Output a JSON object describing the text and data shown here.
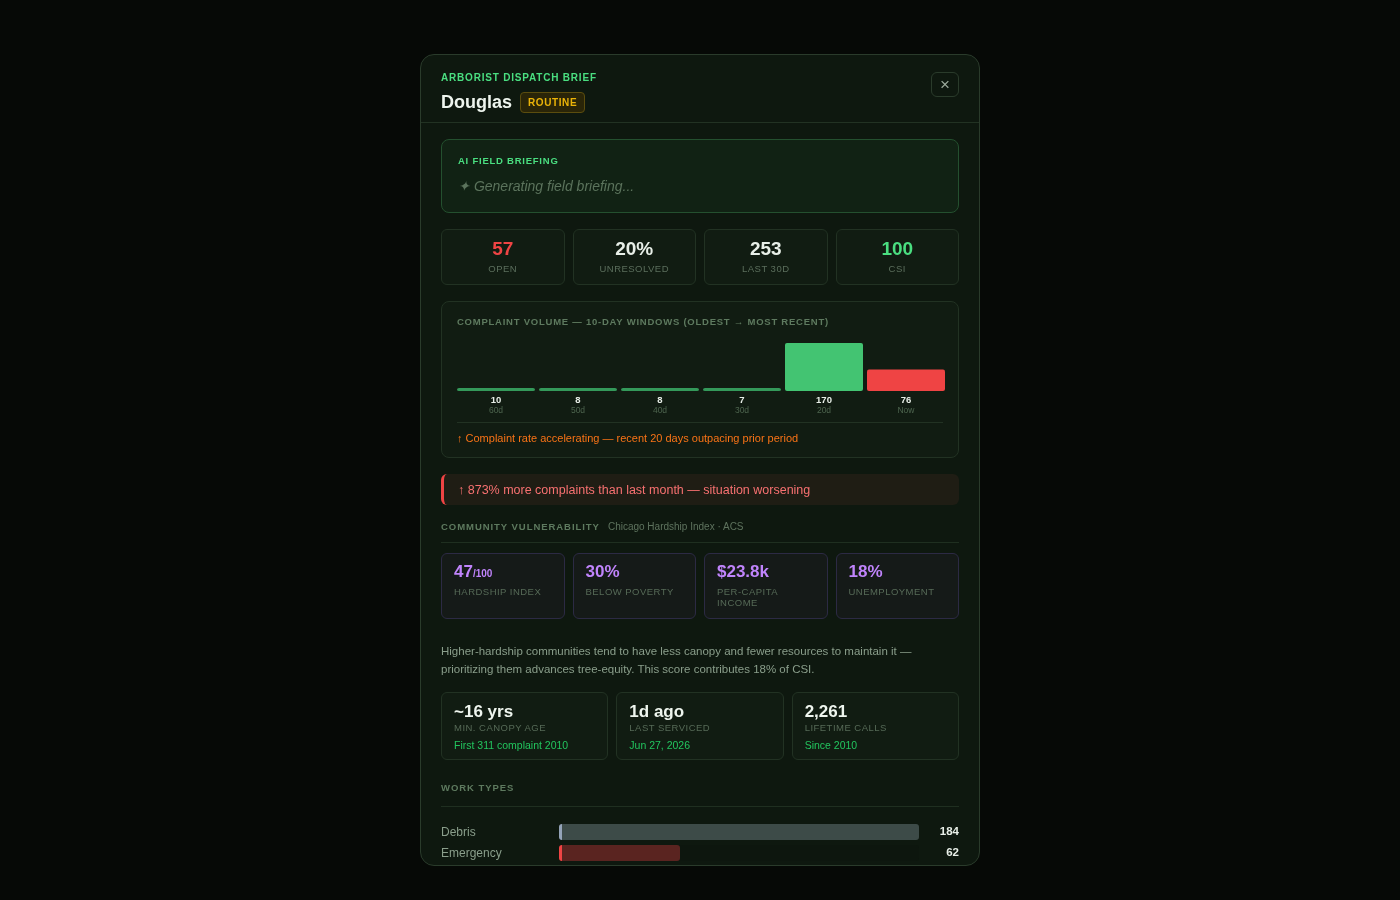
{
  "modal": {
    "eyebrow": "ARBORIST DISPATCH BRIEF",
    "title": "Douglas",
    "priority": "ROUTINE",
    "close": "×"
  },
  "briefing": {
    "heading": "AI FIELD BRIEFING",
    "status": "✦ Generating field briefing..."
  },
  "stats": [
    {
      "value": "57",
      "label": "OPEN",
      "color": "#ef4444"
    },
    {
      "value": "20%",
      "label": "UNRESOLVED",
      "color": "#e8efe8"
    },
    {
      "value": "253",
      "label": "LAST 30D",
      "color": "#e8efe8"
    },
    {
      "value": "100",
      "label": "CSI",
      "color": "#4ade80"
    }
  ],
  "volume": {
    "title": "COMPLAINT VOLUME — 10-DAY WINDOWS (OLDEST → MOST RECENT)",
    "chart_data": {
      "type": "bar",
      "categories": [
        "60d",
        "50d",
        "40d",
        "30d",
        "20d",
        "Now"
      ],
      "data_labels": true,
      "series": [
        {
          "color": "#34995a",
          "values": [
            10,
            8,
            8,
            7,
            null,
            null
          ]
        },
        {
          "color": "#43c472",
          "values": [
            null,
            null,
            null,
            null,
            170,
            null
          ]
        },
        {
          "color": "#ef4444",
          "values": [
            null,
            null,
            null,
            null,
            null,
            76
          ]
        }
      ]
    },
    "note": "↑ Complaint rate accelerating — recent 20 days outpacing prior period"
  },
  "alert": "↑ 873% more complaints than last month — situation worsening",
  "vulnerability": {
    "heading": "COMMUNITY VULNERABILITY",
    "source": "Chicago Hardship Index · ACS",
    "metrics": [
      {
        "value": "47",
        "suffix": "/100",
        "label": "HARDSHIP INDEX"
      },
      {
        "value": "30%",
        "label": "BELOW POVERTY"
      },
      {
        "value": "$23.8k",
        "label": "PER-CAPITA INCOME"
      },
      {
        "value": "18%",
        "label": "UNEMPLOYMENT"
      }
    ],
    "note": "Higher-hardship communities tend to have less canopy and fewer resources to maintain it — prioritizing them advances tree-equity. This score contributes 18% of CSI."
  },
  "history": [
    {
      "value": "~16 yrs",
      "label": "MIN. CANOPY AGE",
      "detail": "First 311 complaint 2010"
    },
    {
      "value": "1d ago",
      "label": "LAST SERVICED",
      "detail": "Jun 27, 2026"
    },
    {
      "value": "2,261",
      "label": "LIFETIME CALLS",
      "detail": "Since 2010"
    }
  ],
  "work_types": {
    "heading": "WORK TYPES",
    "rows": [
      {
        "name": "Debris",
        "count": "184",
        "level": 1.0,
        "color": "#94a3b8"
      },
      {
        "name": "Emergency",
        "count": "62",
        "level": 0.337,
        "color": "#ef4444"
      }
    ]
  }
}
